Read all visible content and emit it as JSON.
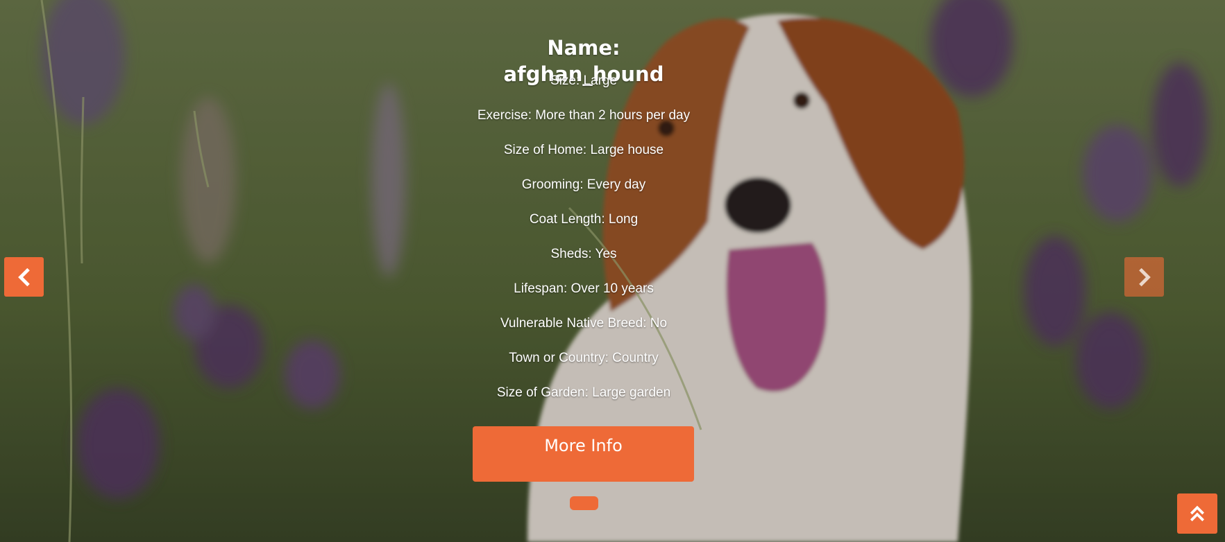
{
  "background": {
    "image": "dog-in-lavender-field",
    "accent": "#ee6a37"
  },
  "dog": {
    "title": "Name: afghan_hound",
    "details": [
      "Size: Large",
      "Exercise: More than 2 hours per day",
      "Size of Home: Large house",
      "Grooming: Every day",
      "Coat Length: Long",
      "Sheds: Yes",
      "Lifespan: Over 10 years",
      "Vulnerable Native Breed: No",
      "Town or Country: Country",
      "Size of Garden: Large garden"
    ]
  },
  "actions": {
    "more_info_label": "More Info"
  },
  "carousel": {
    "prev_icon": "chevron-left-icon",
    "next_icon": "chevron-right-icon",
    "indicator_count": 1,
    "active_index": 0
  },
  "scroll_top": {
    "icon": "double-chevron-up-icon"
  }
}
